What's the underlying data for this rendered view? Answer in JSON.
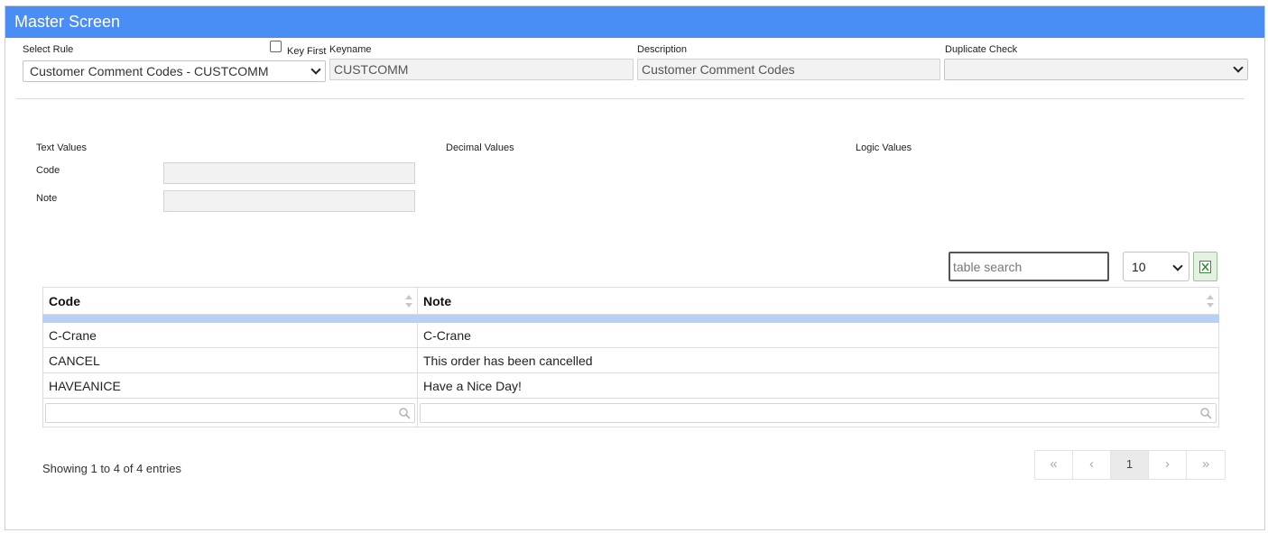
{
  "window": {
    "title": "Master Screen"
  },
  "form": {
    "select_rule_label": "Select Rule",
    "select_rule_value": "Customer Comment Codes - CUSTCOMM",
    "key_first_label": "Key First",
    "keyname_label": "Keyname",
    "keyname_value": "CUSTCOMM",
    "description_label": "Description",
    "description_value": "Customer Comment Codes",
    "duplicate_check_label": "Duplicate Check",
    "duplicate_check_value": ""
  },
  "values": {
    "text_label": "Text Values",
    "decimal_label": "Decimal Values",
    "logic_label": "Logic Values",
    "code_label": "Code",
    "note_label": "Note",
    "code_value": "",
    "note_value": ""
  },
  "table": {
    "search_placeholder": "table search",
    "page_size": "10",
    "columns": [
      "Code",
      "Note"
    ],
    "rows": [
      {
        "code": "C-Crane",
        "note": "C-Crane"
      },
      {
        "code": "CANCEL",
        "note": "This order has been cancelled"
      },
      {
        "code": "HAVEANICE",
        "note": "Have a Nice Day!"
      }
    ],
    "info": "Showing 1 to 4 of 4 entries",
    "pager": {
      "first": "«",
      "prev": "‹",
      "current": "1",
      "next": "›",
      "last": "»"
    }
  },
  "icons": {
    "excel": "excel-export-icon",
    "search": "magnifier-icon",
    "sort": "sort-both-icon"
  },
  "colors": {
    "titlebar": "#4a8ef5",
    "selected_row": "#b7d0f7"
  }
}
